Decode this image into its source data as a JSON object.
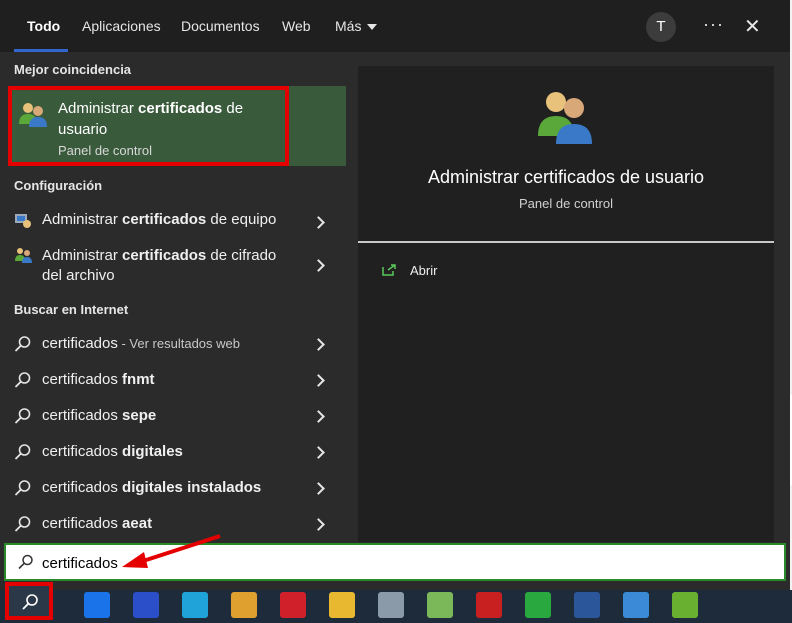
{
  "tabs": [
    "Todo",
    "Aplicaciones",
    "Documentos",
    "Web",
    "Más"
  ],
  "avatar_initial": "T",
  "more_options": "···",
  "close": "✕",
  "sections": {
    "best": "Mejor coincidencia",
    "config": "Configuración",
    "internet": "Buscar en Internet"
  },
  "best_match": {
    "title_pre": "Administrar ",
    "title_bold": "certificados",
    "title_post": " de usuario",
    "subtitle": "Panel de control"
  },
  "config_items": [
    {
      "pre": "Administrar ",
      "bold": "certificados",
      "post": " de equipo"
    },
    {
      "pre": "Administrar ",
      "bold": "certificados",
      "post": " de cifrado del archivo"
    }
  ],
  "web_items": [
    {
      "pre": "certificados",
      "bold": "",
      "sub": " - Ver resultados web"
    },
    {
      "pre": "certificados ",
      "bold": "fnmt",
      "sub": ""
    },
    {
      "pre": "certificados ",
      "bold": "sepe",
      "sub": ""
    },
    {
      "pre": "certificados ",
      "bold": "digitales",
      "sub": ""
    },
    {
      "pre": "certificados ",
      "bold": "digitales instalados",
      "sub": ""
    },
    {
      "pre": "certificados ",
      "bold": "aeat",
      "sub": ""
    }
  ],
  "preview": {
    "title": "Administrar certificados de usuario",
    "subtitle": "Panel de control",
    "open_label": "Abrir"
  },
  "search": {
    "value": "certificados"
  },
  "taskbar_icons": [
    {
      "name": "todo-icon",
      "color": "#1a73e8"
    },
    {
      "name": "save-icon",
      "color": "#2a4fc8"
    },
    {
      "name": "edge-icon",
      "color": "#1fa3d8"
    },
    {
      "name": "chrome-icon",
      "color": "#e0a030"
    },
    {
      "name": "opera-icon",
      "color": "#d0202a"
    },
    {
      "name": "folder-icon",
      "color": "#e8b830"
    },
    {
      "name": "monitor-icon",
      "color": "#8a9aa8"
    },
    {
      "name": "notepad-icon",
      "color": "#7ab85a"
    },
    {
      "name": "acrobat-icon",
      "color": "#c82020"
    },
    {
      "name": "evernote-icon",
      "color": "#2aa840"
    },
    {
      "name": "word-icon",
      "color": "#2b579a"
    },
    {
      "name": "wordpad-icon",
      "color": "#3a8ad8"
    },
    {
      "name": "spreadsheet-icon",
      "color": "#6ab030"
    }
  ]
}
